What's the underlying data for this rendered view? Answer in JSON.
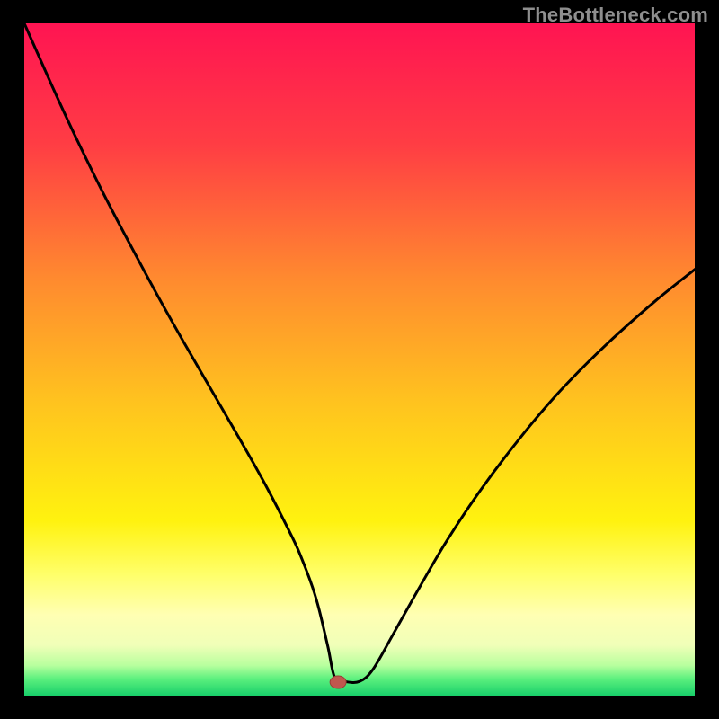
{
  "watermark": "TheBottleneck.com",
  "colors": {
    "curve_stroke": "#000000",
    "marker_fill": "#c0574e",
    "marker_stroke": "#9c3d36",
    "frame_bg": "#000000"
  },
  "gradient_stops": [
    {
      "offset": 0.0,
      "color": "#ff1452"
    },
    {
      "offset": 0.18,
      "color": "#ff3d44"
    },
    {
      "offset": 0.38,
      "color": "#ff8a2f"
    },
    {
      "offset": 0.56,
      "color": "#ffc21f"
    },
    {
      "offset": 0.74,
      "color": "#fff20f"
    },
    {
      "offset": 0.82,
      "color": "#ffff6a"
    },
    {
      "offset": 0.88,
      "color": "#ffffb3"
    },
    {
      "offset": 0.925,
      "color": "#f0ffb8"
    },
    {
      "offset": 0.955,
      "color": "#b8ff9e"
    },
    {
      "offset": 0.975,
      "color": "#5cf07e"
    },
    {
      "offset": 1.0,
      "color": "#18cf6a"
    }
  ],
  "chart_data": {
    "type": "line",
    "title": "",
    "xlabel": "",
    "ylabel": "",
    "xlim": [
      0,
      100
    ],
    "ylim": [
      0,
      100
    ],
    "x": [
      0,
      2,
      5,
      8,
      12,
      16,
      20,
      24,
      28,
      32,
      36,
      40,
      41.5,
      43,
      44,
      45.3,
      46.3,
      47.8,
      50,
      52,
      55,
      59,
      63,
      68,
      74,
      80,
      87,
      94,
      100
    ],
    "values": [
      100,
      95.5,
      88.8,
      82.4,
      74.3,
      66.7,
      59.3,
      52.2,
      45.3,
      38.4,
      31.3,
      23.5,
      20.1,
      16.1,
      12.7,
      7.2,
      2.7,
      2.1,
      2.1,
      3.9,
      9.1,
      16.2,
      23.0,
      30.5,
      38.4,
      45.4,
      52.4,
      58.6,
      63.4
    ],
    "marker": {
      "x": 46.8,
      "y": 2.0
    },
    "annotations": []
  }
}
